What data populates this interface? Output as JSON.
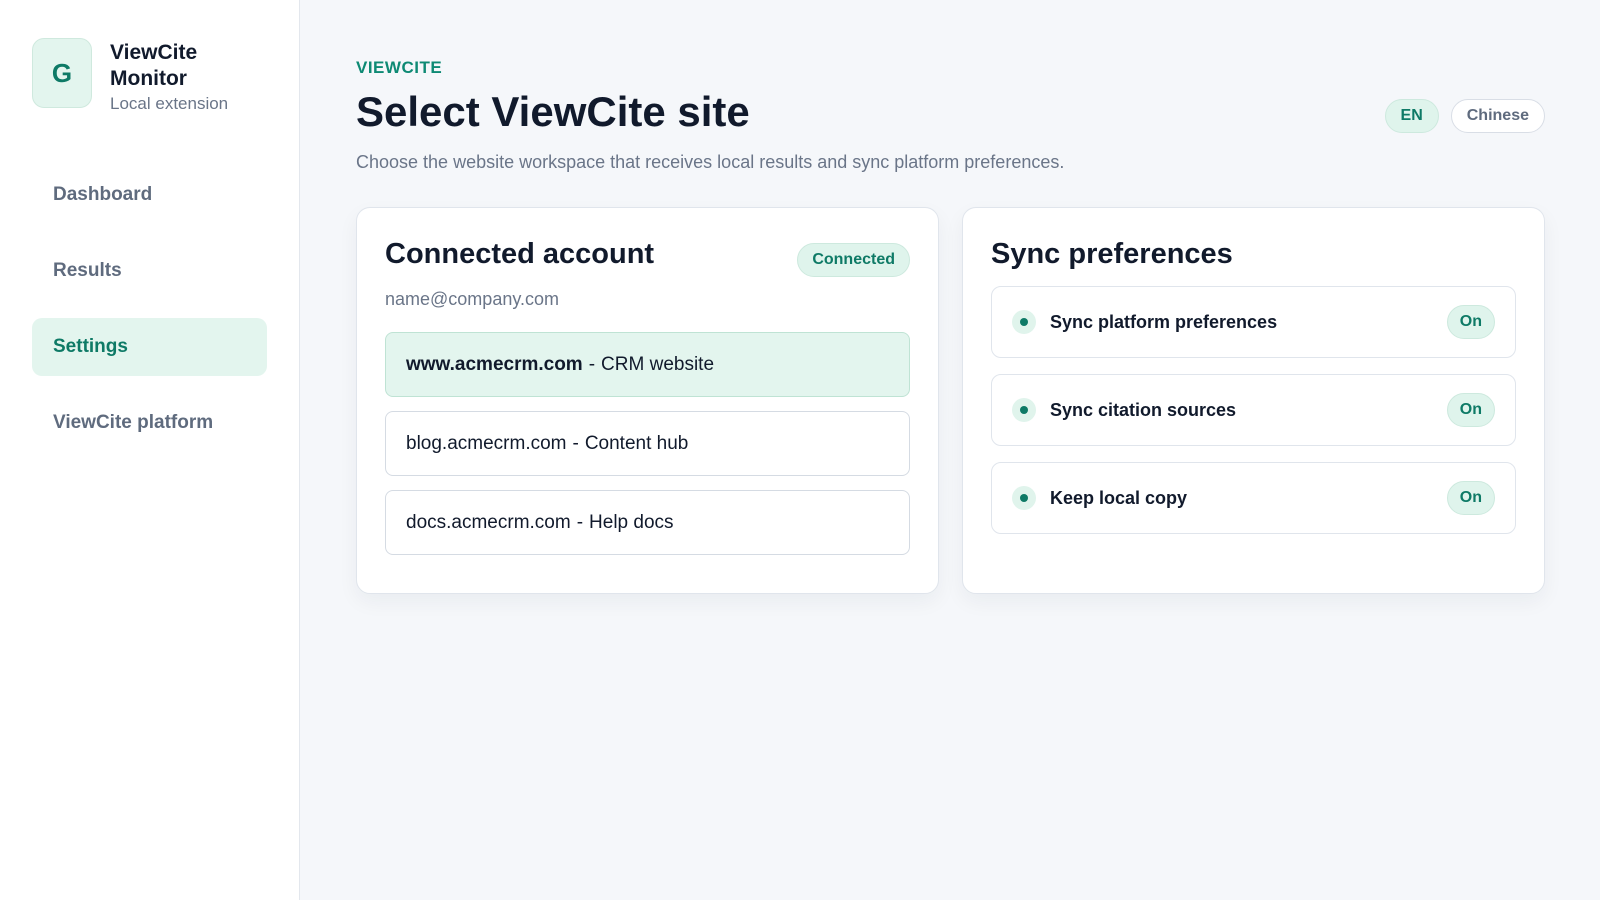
{
  "brand": {
    "logo_letter": "G",
    "title": "ViewCite Monitor",
    "subtitle": "Local extension"
  },
  "nav": {
    "items": [
      {
        "label": "Dashboard",
        "active": false
      },
      {
        "label": "Results",
        "active": false
      },
      {
        "label": "Settings",
        "active": true
      },
      {
        "label": "ViewCite platform",
        "active": false
      }
    ]
  },
  "header": {
    "eyebrow": "VIEWCITE",
    "title": "Select ViewCite site",
    "description": "Choose the website workspace that receives local results and sync platform preferences."
  },
  "language": {
    "options": [
      {
        "label": "EN",
        "active": true
      },
      {
        "label": "Chinese",
        "active": false
      }
    ]
  },
  "account": {
    "title": "Connected account",
    "status": "Connected",
    "email": "name@company.com",
    "sites": [
      {
        "domain": "www.acmecrm.com",
        "separator": "-",
        "name": "CRM website",
        "selected": true
      },
      {
        "domain": "blog.acmecrm.com",
        "separator": "-",
        "name": "Content hub",
        "selected": false
      },
      {
        "domain": "docs.acmecrm.com",
        "separator": "-",
        "name": "Help docs",
        "selected": false
      }
    ]
  },
  "sync": {
    "title": "Sync preferences",
    "items": [
      {
        "label": "Sync platform preferences",
        "state": "On"
      },
      {
        "label": "Sync citation sources",
        "state": "On"
      },
      {
        "label": "Keep local copy",
        "state": "On"
      }
    ]
  },
  "colors": {
    "accent": "#0e7a66",
    "accent_soft": "#e3f5ee",
    "text": "#111a2c",
    "muted": "#6a7588"
  }
}
